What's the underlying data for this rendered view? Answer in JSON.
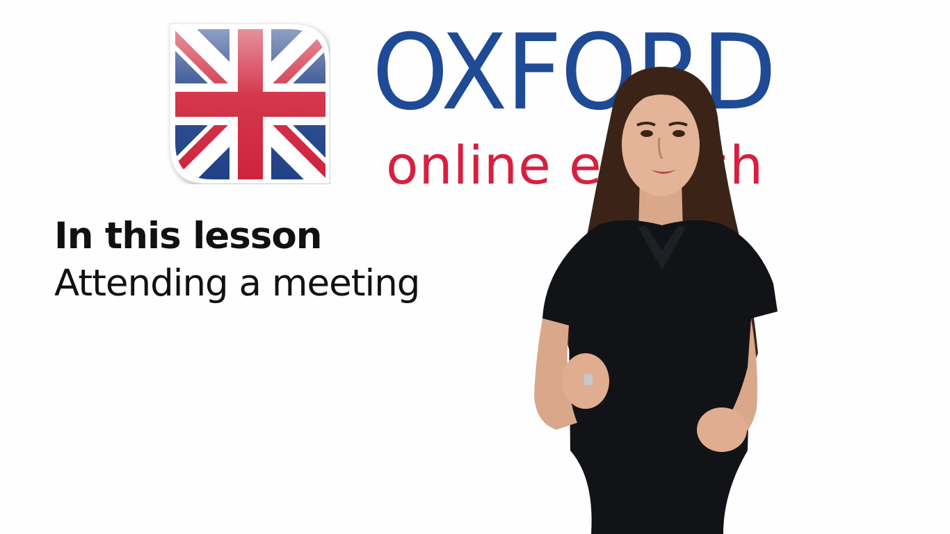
{
  "brand": {
    "name": "OXFORD",
    "tagline": "online english",
    "logo_icon": "union-jack-flag-icon",
    "name_color": "#1f4a96",
    "tagline_color": "#d81f3e"
  },
  "lesson": {
    "heading": "In this lesson",
    "topic": "Attending a meeting"
  },
  "presenter": {
    "image": "presenter-woman-black-polo"
  },
  "colors": {
    "background": "#fefefe",
    "flag_red": "#cf2139",
    "flag_blue": "#1d3f86",
    "text": "#111111"
  }
}
